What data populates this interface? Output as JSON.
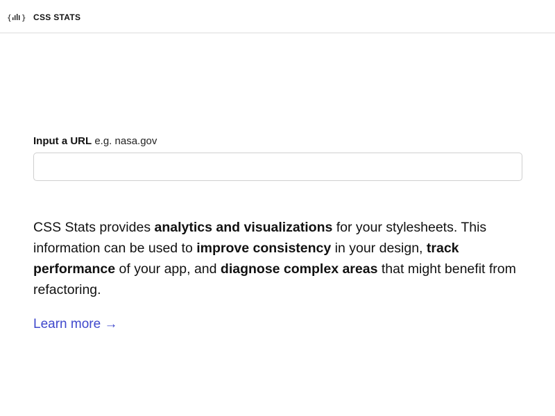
{
  "header": {
    "brand_name": "CSS STATS",
    "logo_icon": "bar-chart-braces-icon"
  },
  "form": {
    "label_strong": "Input a URL",
    "label_hint": "e.g. nasa.gov",
    "input_value": "",
    "input_placeholder": ""
  },
  "description": {
    "part1": "CSS Stats provides ",
    "strong1": "analytics and visualizations",
    "part2": " for your stylesheets. This information can be used to ",
    "strong2": "improve consistency",
    "part3": " in your design, ",
    "strong3": "track performance",
    "part4": " of your app, and ",
    "strong4": "diagnose complex areas",
    "part5": " that might benefit from refactoring."
  },
  "links": {
    "learn_more": "Learn more →"
  },
  "colors": {
    "link": "#3f48cc",
    "border": "#cfcfcf",
    "text": "#111111",
    "background": "#ffffff"
  }
}
